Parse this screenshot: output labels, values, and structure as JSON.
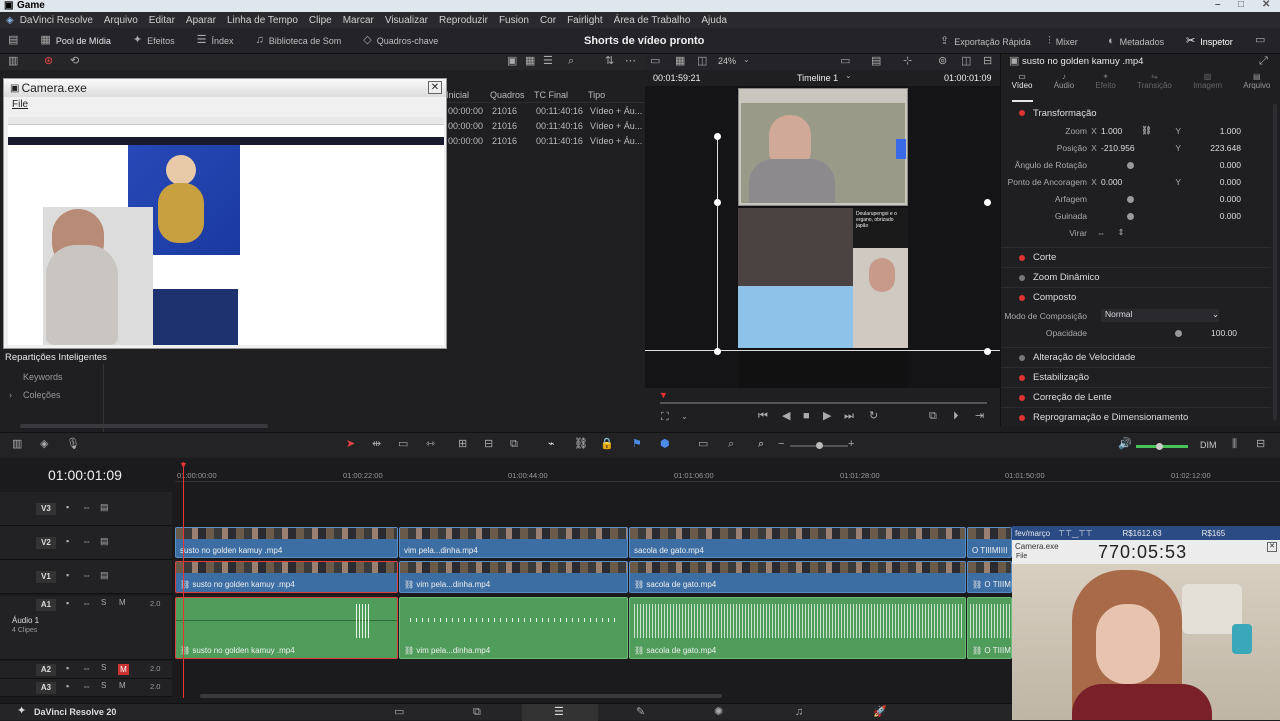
{
  "app": {
    "title": "Game",
    "name": "DaVinci Resolve 20"
  },
  "menu": [
    "DaVinci Resolve",
    "Arquivo",
    "Editar",
    "Aparar",
    "Linha de Tempo",
    "Clipe",
    "Marcar",
    "Visualizar",
    "Reproduzir",
    "Fusion",
    "Cor",
    "Fairlight",
    "Área de Trabalho",
    "Ajuda"
  ],
  "toolbar": {
    "media_pool": "Pool de Mídia",
    "effects": "Efeitos",
    "index": "Índex",
    "sound_library": "Biblioteca de Som",
    "keyframes": "Quadros-chave",
    "project_title": "Shorts de vídeo pronto",
    "quick_export": "Exportação Rápida",
    "mixer": "Mixer",
    "metadata": "Metadados",
    "inspector": "Inspetor"
  },
  "media_pool": {
    "columns": [
      "Inicial",
      "Quadros",
      "TC Final",
      "Tipo"
    ],
    "rows": [
      [
        "00:00:00",
        "21016",
        "00:11:40:16",
        "Vídeo + Áu..."
      ],
      [
        "00:00:00",
        "21016",
        "00:11:40:16",
        "Vídeo + Áu..."
      ],
      [
        "00:00:00",
        "21016",
        "00:11:40:16",
        "Vídeo + Áu..."
      ]
    ],
    "smart_bins": "Repartições Inteligentes",
    "keywords": "Keywords",
    "collections": "Coleções"
  },
  "camera_window": {
    "title": "Camera.exe",
    "menu": "File"
  },
  "viewer": {
    "zoom": "24%",
    "timecode_left": "00:01:59:21",
    "timeline_name": "Timeline 1",
    "timecode_right": "01:00:01:09",
    "clip_text_1": "Deularupengoi e o ergano, obrizado japão"
  },
  "inspector": {
    "clip_name": "susto no golden kamuy .mp4",
    "tabs": [
      "Vídeo",
      "Áudio",
      "Efeito",
      "Transição",
      "Imagem",
      "Arquivo"
    ],
    "transform_title": "Transformação",
    "zoom_label": "Zoom",
    "zoom_x": "1.000",
    "zoom_y": "1.000",
    "position_label": "Posição",
    "pos_x": "-210.956",
    "pos_y": "223.648",
    "rotation_label": "Ângulo de Rotação",
    "rotation": "0.000",
    "anchor_label": "Ponto de Ancoragem",
    "anchor_x": "0.000",
    "anchor_y": "0.000",
    "pitch_label": "Arfagem",
    "pitch": "0.000",
    "yaw_label": "Guinada",
    "yaw": "0.000",
    "flip_label": "Virar",
    "axis_x": "X",
    "axis_y": "Y",
    "sections": [
      "Corte",
      "Zoom Dinâmico",
      "Composto"
    ],
    "composite_mode_label": "Modo de Composição",
    "composite_mode": "Normal",
    "opacity_label": "Opacidade",
    "opacity": "100.00",
    "sections2": [
      "Alteração de Velocidade",
      "Estabilização",
      "Correção de Lente",
      "Reprogramação e Dimensionamento"
    ]
  },
  "timeline": {
    "timecode": "01:00:01:09",
    "ruler": [
      "01:00:00:00",
      "01:00:22:00",
      "01:00:44:00",
      "01:01:06:00",
      "01:01:28:00",
      "01:01:50:00",
      "01:02:12:00"
    ],
    "dim": "DIM",
    "tracks": {
      "v3": "V3",
      "v2": "V2",
      "v1": "V1",
      "a1": "A1",
      "a1_name": "Áudio 1",
      "a1_clips": "4 Clipes",
      "a1_level": "2.0",
      "a2": "A2",
      "a2_level": "2.0",
      "a3": "A3",
      "a3_level": "2.0"
    },
    "clips": [
      "susto no golden kamuy .mp4",
      "vim pela...dinha.mp4",
      "sacola de gato.mp4",
      "O TIIIMIIII"
    ]
  },
  "overlay": {
    "month": "fev/março",
    "amount1": "R$1612.63",
    "amount2": "R$165",
    "camera_title": "Camera.exe",
    "camera_menu": "File",
    "counter": "770:05:53"
  }
}
